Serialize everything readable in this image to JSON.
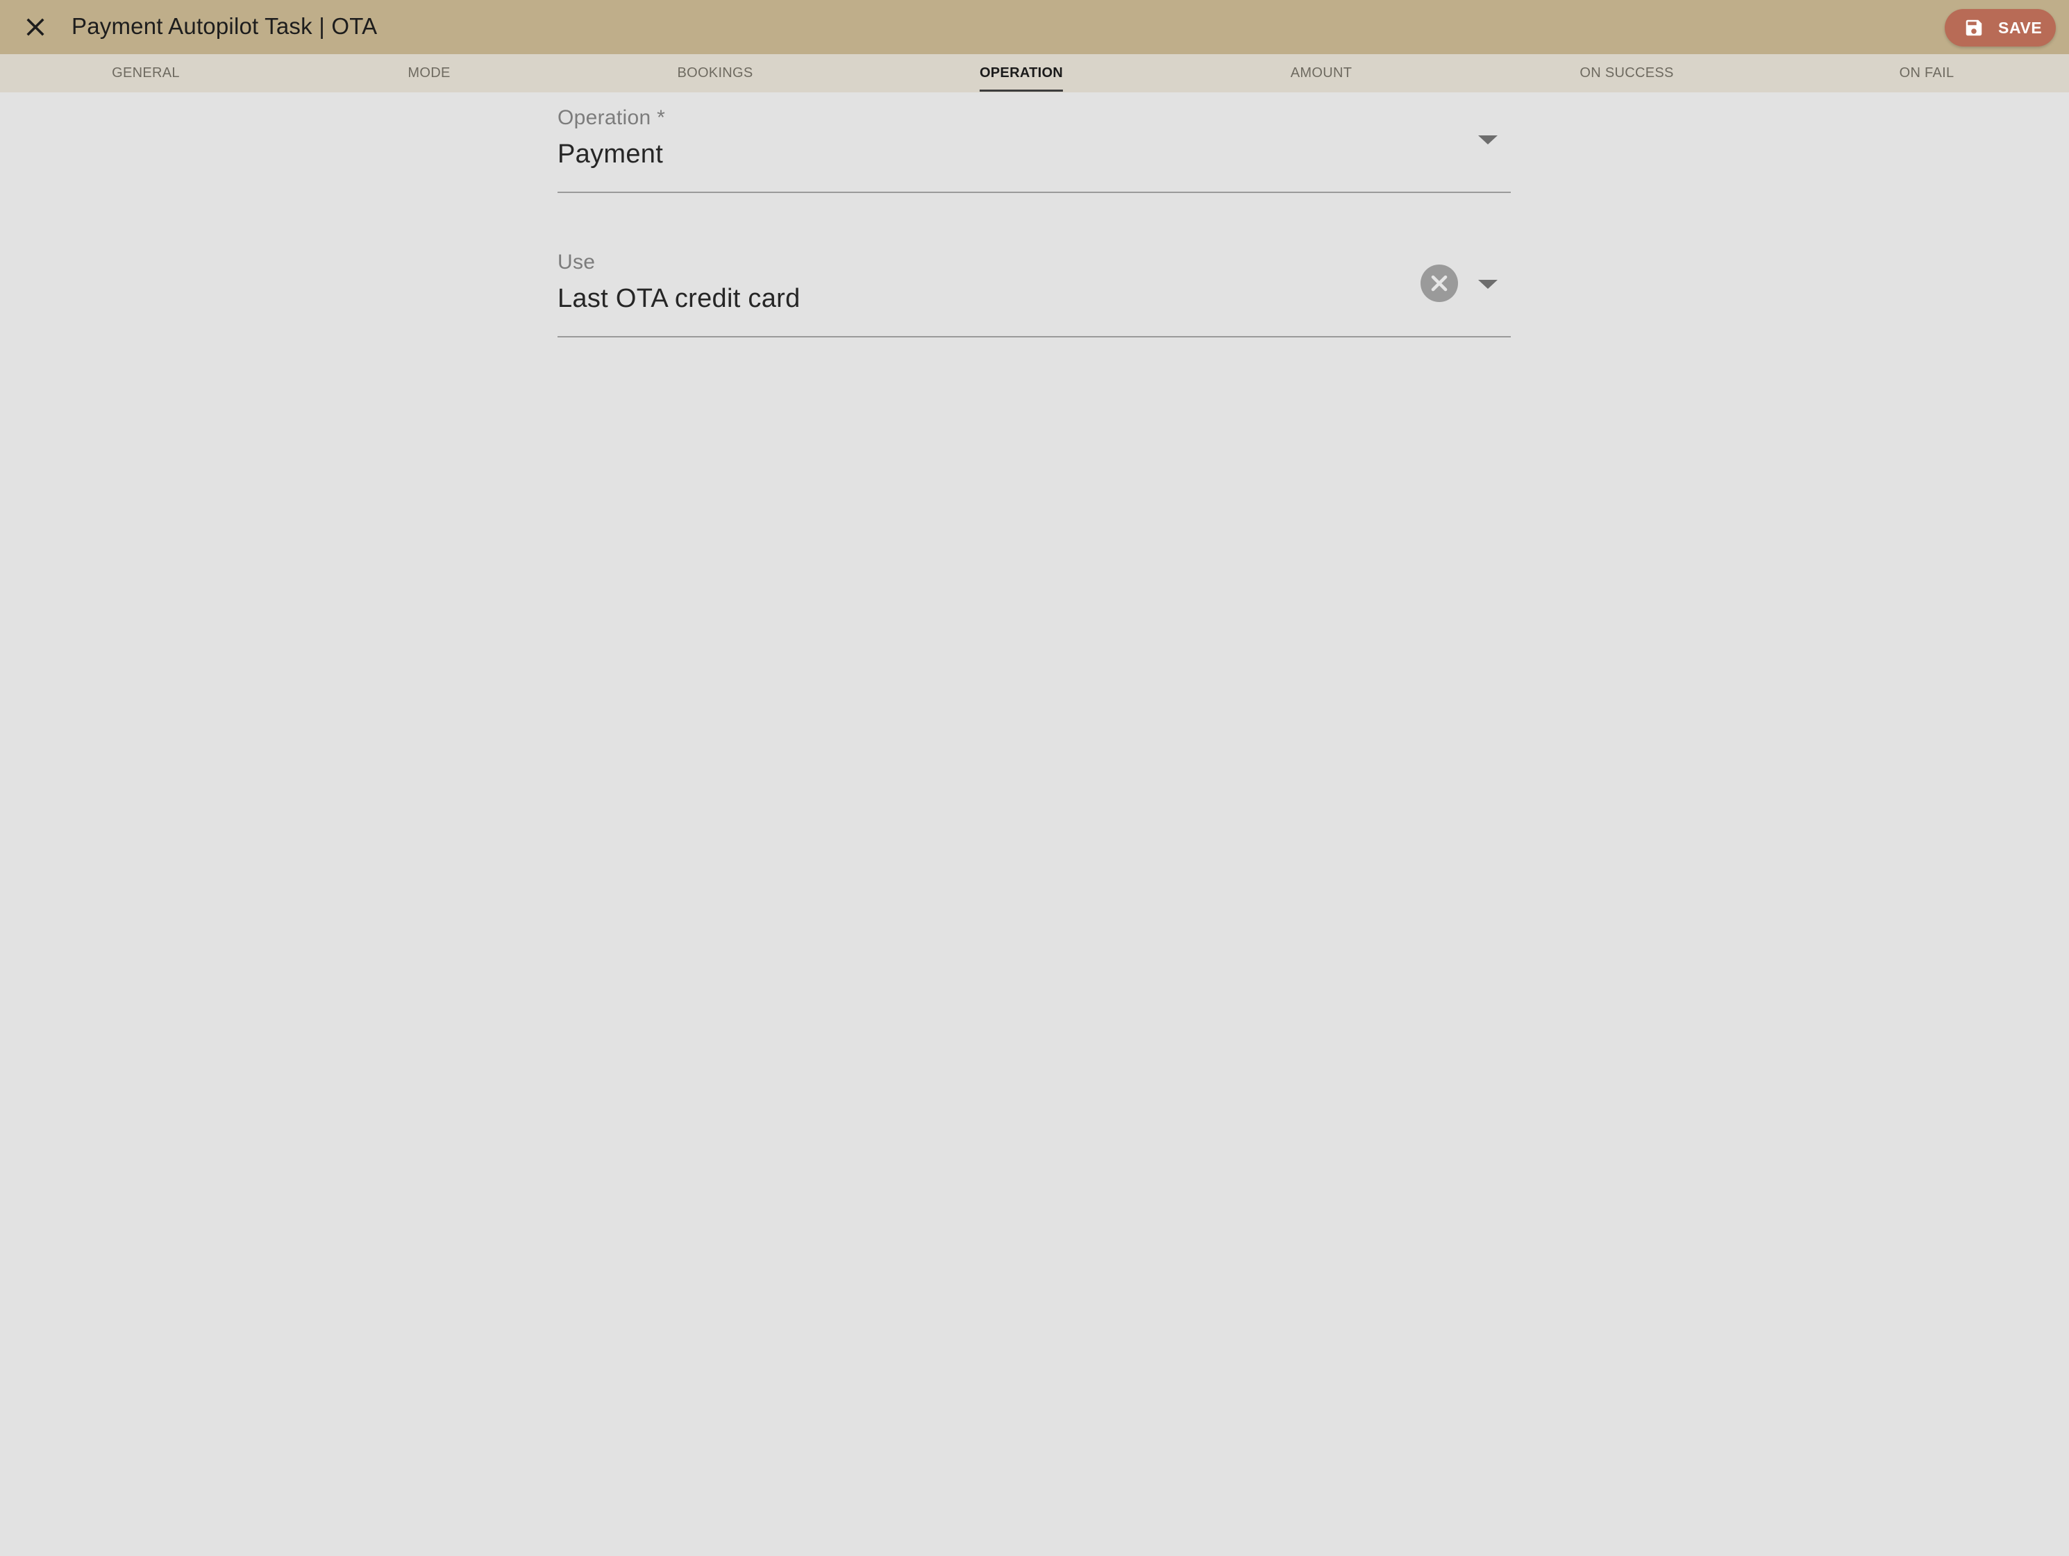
{
  "header": {
    "title": "Payment Autopilot Task | OTA",
    "close_icon": "close-icon",
    "save_label": "SAVE",
    "save_icon": "floppy-disk-icon",
    "colors": {
      "bar": "#bfae8a",
      "save_button": "#b86b56"
    }
  },
  "tabs": [
    {
      "label": "GENERAL",
      "active": false
    },
    {
      "label": "MODE",
      "active": false
    },
    {
      "label": "BOOKINGS",
      "active": false
    },
    {
      "label": "OPERATION",
      "active": true
    },
    {
      "label": "AMOUNT",
      "active": false
    },
    {
      "label": "ON SUCCESS",
      "active": false
    },
    {
      "label": "ON FAIL",
      "active": false
    }
  ],
  "form": {
    "operation": {
      "label": "Operation *",
      "value": "Payment"
    },
    "use": {
      "label": "Use",
      "value": "Last OTA credit card"
    }
  }
}
